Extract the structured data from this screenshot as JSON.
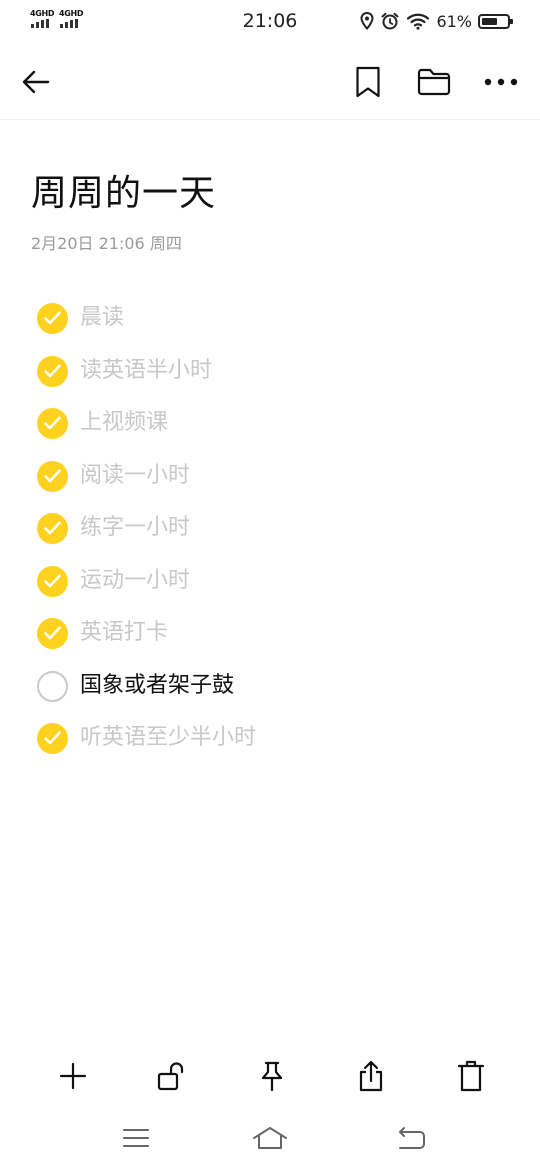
{
  "status_bar": {
    "sim1_label": "4GHD",
    "sim2_label": "4GHD",
    "time": "21:06",
    "battery_percent": "61%",
    "battery_level": 0.61,
    "icons": [
      "location-icon",
      "alarm-icon",
      "wifi-icon",
      "battery-icon"
    ]
  },
  "header": {
    "icons": [
      "back-arrow-icon",
      "bookmark-icon",
      "folder-icon",
      "more-icon"
    ]
  },
  "note": {
    "title": "周周的一天",
    "meta": "2月20日 21:06 周四"
  },
  "checklist": [
    {
      "text": "晨读",
      "done": true
    },
    {
      "text": "读英语半小时",
      "done": true
    },
    {
      "text": "上视频课",
      "done": true
    },
    {
      "text": "阅读一小时",
      "done": true
    },
    {
      "text": "练字一小时",
      "done": true
    },
    {
      "text": "运动一小时",
      "done": true
    },
    {
      "text": "英语打卡",
      "done": true
    },
    {
      "text": "国象或者架子鼓",
      "done": false
    },
    {
      "text": "听英语至少半小时",
      "done": true
    }
  ],
  "toolbar": {
    "icons": [
      "plus-icon",
      "unlock-icon",
      "pin-icon",
      "share-icon",
      "trash-icon"
    ]
  },
  "nav_bar": {
    "icons": [
      "menu-icon",
      "home-icon",
      "return-icon"
    ]
  },
  "colors": {
    "accent": "#ffd21f",
    "done_text": "#c8c8c8",
    "meta_text": "#999999"
  }
}
